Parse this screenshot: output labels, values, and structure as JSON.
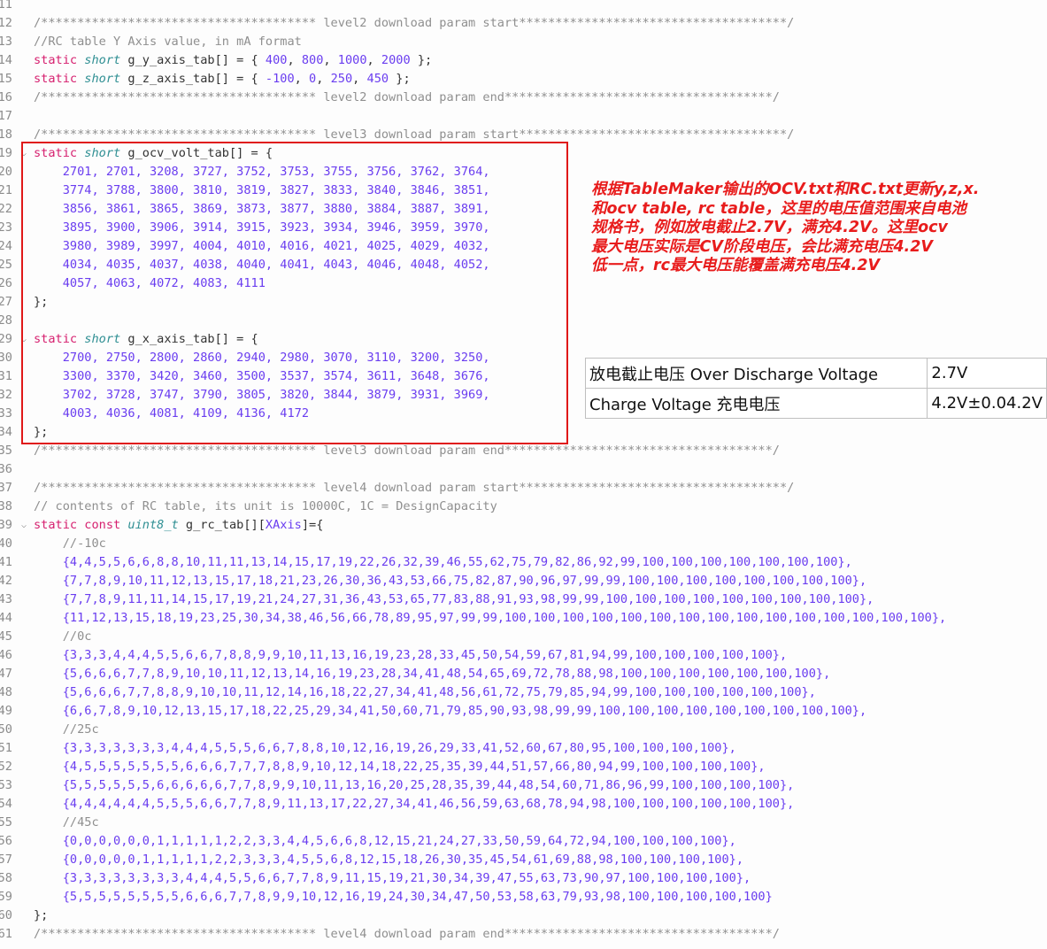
{
  "editor": {
    "lines": [
      {
        "n": "11",
        "tokens": []
      },
      {
        "n": "12",
        "tokens": [
          [
            "cm",
            "/************************************** level2 download param start*************************************/"
          ]
        ]
      },
      {
        "n": "13",
        "tokens": [
          [
            "cm",
            "//RC table Y Axis value, in mA format"
          ]
        ]
      },
      {
        "n": "14",
        "tokens": [
          [
            "kw",
            "static "
          ],
          [
            "ty",
            "short"
          ],
          [
            "pn",
            " g_y_axis_tab[] = { "
          ],
          [
            "nu",
            "400"
          ],
          [
            "pn",
            ", "
          ],
          [
            "nu",
            "800"
          ],
          [
            "pn",
            ", "
          ],
          [
            "nu",
            "1000"
          ],
          [
            "pn",
            ", "
          ],
          [
            "nu",
            "2000"
          ],
          [
            "pn",
            " };"
          ]
        ]
      },
      {
        "n": "15",
        "tokens": [
          [
            "kw",
            "static "
          ],
          [
            "ty",
            "short"
          ],
          [
            "pn",
            " g_z_axis_tab[] = { "
          ],
          [
            "nu",
            "-100"
          ],
          [
            "pn",
            ", "
          ],
          [
            "nu",
            "0"
          ],
          [
            "pn",
            ", "
          ],
          [
            "nu",
            "250"
          ],
          [
            "pn",
            ", "
          ],
          [
            "nu",
            "450"
          ],
          [
            "pn",
            " };"
          ]
        ]
      },
      {
        "n": "16",
        "tokens": [
          [
            "cm",
            "/************************************** level2 download param end*************************************/"
          ]
        ]
      },
      {
        "n": "17",
        "tokens": []
      },
      {
        "n": "18",
        "tokens": [
          [
            "cm",
            "/************************************** level3 download param start*************************************/"
          ]
        ]
      },
      {
        "n": "19",
        "fold": true,
        "tokens": [
          [
            "kw",
            "static "
          ],
          [
            "ty",
            "short"
          ],
          [
            "pn",
            " g_ocv_volt_tab[] = {"
          ]
        ]
      },
      {
        "n": "20",
        "tokens": [
          [
            "nu",
            "    2701, 2701, 3208, 3727, 3752, 3753, 3755, 3756, 3762, 3764,"
          ]
        ]
      },
      {
        "n": "21",
        "tokens": [
          [
            "nu",
            "    3774, 3788, 3800, 3810, 3819, 3827, 3833, 3840, 3846, 3851,"
          ]
        ]
      },
      {
        "n": "22",
        "tokens": [
          [
            "nu",
            "    3856, 3861, 3865, 3869, 3873, 3877, 3880, 3884, 3887, 3891,"
          ]
        ]
      },
      {
        "n": "23",
        "tokens": [
          [
            "nu",
            "    3895, 3900, 3906, 3914, 3915, 3923, 3934, 3946, 3959, 3970,"
          ]
        ]
      },
      {
        "n": "24",
        "tokens": [
          [
            "nu",
            "    3980, 3989, 3997, 4004, 4010, 4016, 4021, 4025, 4029, 4032,"
          ]
        ]
      },
      {
        "n": "25",
        "tokens": [
          [
            "nu",
            "    4034, 4035, 4037, 4038, 4040, 4041, 4043, 4046, 4048, 4052,"
          ]
        ]
      },
      {
        "n": "26",
        "tokens": [
          [
            "nu",
            "    4057, 4063, 4072, 4083, 4111"
          ]
        ]
      },
      {
        "n": "27",
        "tokens": [
          [
            "pn",
            "};"
          ]
        ]
      },
      {
        "n": "28",
        "tokens": []
      },
      {
        "n": "29",
        "fold": true,
        "tokens": [
          [
            "kw",
            "static "
          ],
          [
            "ty",
            "short"
          ],
          [
            "pn",
            " g_x_axis_tab[] = {"
          ]
        ]
      },
      {
        "n": "30",
        "tokens": [
          [
            "nu",
            "    2700, 2750, 2800, 2860, 2940, 2980, 3070, 3110, 3200, 3250,"
          ]
        ]
      },
      {
        "n": "31",
        "tokens": [
          [
            "nu",
            "    3300, 3370, 3420, 3460, 3500, 3537, 3574, 3611, 3648, 3676,"
          ]
        ]
      },
      {
        "n": "32",
        "tokens": [
          [
            "nu",
            "    3702, 3728, 3747, 3790, 3805, 3820, 3844, 3879, 3931, 3969,"
          ]
        ]
      },
      {
        "n": "33",
        "tokens": [
          [
            "nu",
            "    4003, 4036, 4081, 4109, 4136, 4172"
          ]
        ]
      },
      {
        "n": "34",
        "tokens": [
          [
            "pn",
            "};"
          ]
        ]
      },
      {
        "n": "35",
        "tokens": [
          [
            "cm",
            "/************************************** level3 download param end*************************************/"
          ]
        ]
      },
      {
        "n": "36",
        "tokens": []
      },
      {
        "n": "37",
        "tokens": [
          [
            "cm",
            "/************************************** level4 download param start*************************************/"
          ]
        ]
      },
      {
        "n": "38",
        "tokens": [
          [
            "cm",
            "// contents of RC table, its unit is 10000C, 1C = DesignCapacity"
          ]
        ]
      },
      {
        "n": "39",
        "fold": true,
        "tokens": [
          [
            "kw",
            "static const "
          ],
          [
            "ty",
            "uint8_t"
          ],
          [
            "pn",
            " g_rc_tab[]["
          ],
          [
            "nu",
            "XAxis"
          ],
          [
            "pn",
            "]={"
          ]
        ]
      },
      {
        "n": "40",
        "tokens": [
          [
            "cm",
            "    //-10c"
          ]
        ]
      },
      {
        "n": "41",
        "tokens": [
          [
            "nu",
            "    {4,4,5,5,6,6,8,8,10,11,11,13,14,15,17,19,22,26,32,39,46,55,62,75,79,82,86,92,99,100,100,100,100,100,100,100},"
          ]
        ]
      },
      {
        "n": "42",
        "tokens": [
          [
            "nu",
            "    {7,7,8,9,10,11,12,13,15,17,18,21,23,26,30,36,43,53,66,75,82,87,90,96,97,99,99,100,100,100,100,100,100,100,100},"
          ]
        ]
      },
      {
        "n": "43",
        "tokens": [
          [
            "nu",
            "    {7,7,8,9,11,11,14,15,17,19,21,24,27,31,36,43,53,65,77,83,88,91,93,98,99,99,100,100,100,100,100,100,100,100,100},"
          ]
        ]
      },
      {
        "n": "44",
        "tokens": [
          [
            "nu",
            "    {11,12,13,15,18,19,23,25,30,34,38,46,56,66,78,89,95,97,99,99,100,100,100,100,100,100,100,100,100,100,100,100,100,100,100},"
          ]
        ]
      },
      {
        "n": "45",
        "tokens": [
          [
            "cm",
            "    //0c"
          ]
        ]
      },
      {
        "n": "46",
        "tokens": [
          [
            "nu",
            "    {3,3,3,4,4,4,5,5,6,6,7,8,8,9,9,10,11,13,16,19,23,28,33,45,50,54,59,67,81,94,99,100,100,100,100,100},"
          ]
        ]
      },
      {
        "n": "47",
        "tokens": [
          [
            "nu",
            "    {5,6,6,6,7,7,8,9,10,10,11,12,13,14,16,19,23,28,34,41,48,54,65,69,72,78,88,98,100,100,100,100,100,100,100},"
          ]
        ]
      },
      {
        "n": "48",
        "tokens": [
          [
            "nu",
            "    {5,6,6,6,7,7,8,8,9,10,10,11,12,14,16,18,22,27,34,41,48,56,61,72,75,79,85,94,99,100,100,100,100,100,100},"
          ]
        ]
      },
      {
        "n": "49",
        "tokens": [
          [
            "nu",
            "    {6,6,7,8,9,10,12,13,15,17,18,22,25,29,34,41,50,60,71,79,85,90,93,98,99,99,100,100,100,100,100,100,100,100,100},"
          ]
        ]
      },
      {
        "n": "50",
        "tokens": [
          [
            "cm",
            "    //25c"
          ]
        ]
      },
      {
        "n": "51",
        "tokens": [
          [
            "nu",
            "    {3,3,3,3,3,3,3,4,4,4,5,5,5,6,6,7,8,8,10,12,16,19,26,29,33,41,52,60,67,80,95,100,100,100,100},"
          ]
        ]
      },
      {
        "n": "52",
        "tokens": [
          [
            "nu",
            "    {4,5,5,5,5,5,5,5,6,6,6,7,7,7,8,8,9,10,12,14,18,22,25,35,39,44,51,57,66,80,94,99,100,100,100,100},"
          ]
        ]
      },
      {
        "n": "53",
        "tokens": [
          [
            "nu",
            "    {5,5,5,5,5,5,6,6,6,6,6,7,7,8,9,9,10,11,13,16,20,25,28,35,39,44,48,54,60,71,86,96,99,100,100,100,100},"
          ]
        ]
      },
      {
        "n": "54",
        "tokens": [
          [
            "nu",
            "    {4,4,4,4,4,4,5,5,5,6,6,7,7,8,9,11,13,17,22,27,34,41,46,56,59,63,68,78,94,98,100,100,100,100,100,100},"
          ]
        ]
      },
      {
        "n": "55",
        "tokens": [
          [
            "cm",
            "    //45c"
          ]
        ]
      },
      {
        "n": "56",
        "tokens": [
          [
            "nu",
            "    {0,0,0,0,0,0,1,1,1,1,1,2,2,3,3,4,4,5,6,6,8,12,15,21,24,27,33,50,59,64,72,94,100,100,100,100},"
          ]
        ]
      },
      {
        "n": "57",
        "tokens": [
          [
            "nu",
            "    {0,0,0,0,0,1,1,1,1,1,2,2,3,3,3,4,5,5,6,8,12,15,18,26,30,35,45,54,61,69,88,98,100,100,100,100},"
          ]
        ]
      },
      {
        "n": "58",
        "tokens": [
          [
            "nu",
            "    {3,3,3,3,3,3,3,3,4,4,4,5,5,6,6,7,7,8,9,11,15,19,21,30,34,39,47,55,63,73,90,97,100,100,100,100},"
          ]
        ]
      },
      {
        "n": "59",
        "tokens": [
          [
            "nu",
            "    {5,5,5,5,5,5,5,5,6,6,6,7,7,8,9,9,10,12,16,19,24,30,34,47,50,53,58,63,79,93,98,100,100,100,100,100}"
          ]
        ]
      },
      {
        "n": "60",
        "tokens": [
          [
            "pn",
            "};"
          ]
        ]
      },
      {
        "n": "61",
        "tokens": [
          [
            "cm",
            "/************************************** level4 download param end*************************************/"
          ]
        ]
      }
    ]
  },
  "annotation": {
    "lines": [
      "根据TableMaker输出的OCV.txt和RC.txt更新y,z,x.",
      "和ocv table, rc table，这里的电压值范围来自电池",
      "规格书，例如放电截止2.7V，满充4.2V。这里ocv",
      "最大电压实际是CV阶段电压，会比满充电压4.2V",
      "低一点，rc最大电压能覆盖满充电压4.2V"
    ]
  },
  "spec_table": {
    "rows": [
      {
        "label": "放电截止电压  Over Discharge Voltage",
        "value": "2.7V"
      },
      {
        "label": "Charge Voltage  充电电压",
        "value": "4.2V±0.04.2V"
      }
    ]
  },
  "colors": {
    "highlight_border": "#e01818",
    "annotation_text": "#e81c1c",
    "keyword": "#d6206f",
    "type": "#2f8f93",
    "number": "#6a3df0",
    "comment": "#8f8f8f"
  }
}
